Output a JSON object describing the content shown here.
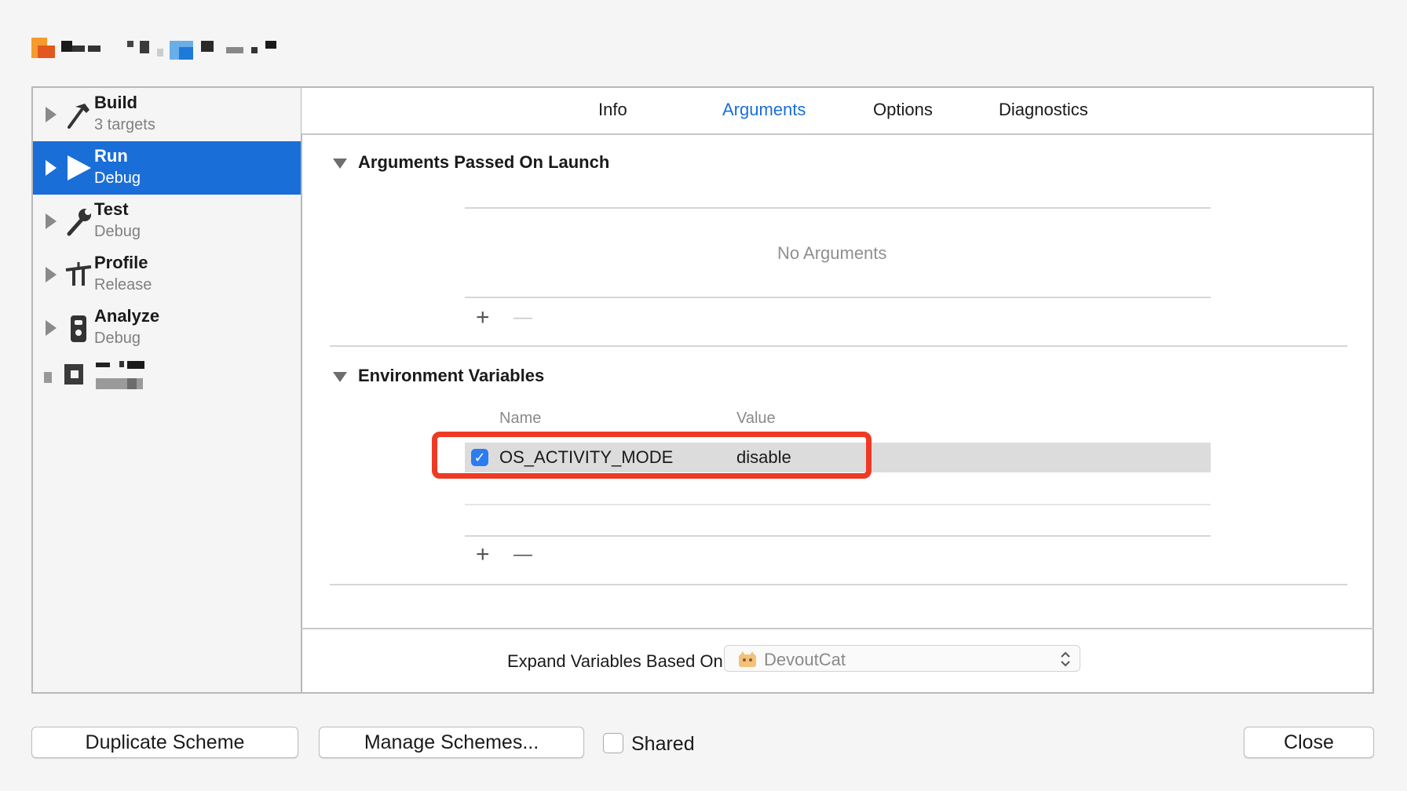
{
  "sidebar": {
    "items": [
      {
        "title": "Build",
        "subtitle": "3 targets",
        "icon": "hammer-icon"
      },
      {
        "title": "Run",
        "subtitle": "Debug",
        "icon": "play-icon",
        "selected": true
      },
      {
        "title": "Test",
        "subtitle": "Debug",
        "icon": "wrench-icon"
      },
      {
        "title": "Profile",
        "subtitle": "Release",
        "icon": "instruments-icon"
      },
      {
        "title": "Analyze",
        "subtitle": "Debug",
        "icon": "analyzer-icon"
      }
    ]
  },
  "tabs": [
    {
      "label": "Info"
    },
    {
      "label": "Arguments",
      "active": true
    },
    {
      "label": "Options"
    },
    {
      "label": "Diagnostics"
    }
  ],
  "arguments_section": {
    "title": "Arguments Passed On Launch",
    "empty_text": "No Arguments",
    "add_label": "+",
    "remove_label": "—"
  },
  "env_section": {
    "title": "Environment Variables",
    "columns": {
      "name": "Name",
      "value": "Value"
    },
    "rows": [
      {
        "enabled": true,
        "check_glyph": "✓",
        "name": "OS_ACTIVITY_MODE",
        "value": "disable"
      }
    ],
    "add_label": "+",
    "remove_label": "—",
    "highlight_color": "#ee3a24"
  },
  "expand": {
    "label": "Expand Variables Based On",
    "value": "DevoutCat",
    "stepper_glyph": "⌃⌄"
  },
  "footer": {
    "duplicate_label": "Duplicate Scheme",
    "manage_label": "Manage Schemes...",
    "shared_label": "Shared",
    "close_label": "Close"
  },
  "colors": {
    "accent": "#1a6ed8",
    "selection": "#1a6ed8"
  }
}
